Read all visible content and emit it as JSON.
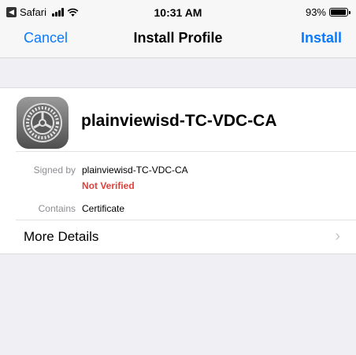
{
  "status_bar": {
    "app_name": "Safari",
    "time": "10:31 AM",
    "battery_percent": "93%",
    "battery_level": 0.93
  },
  "nav": {
    "cancel_label": "Cancel",
    "title": "Install Profile",
    "install_label": "Install"
  },
  "profile": {
    "name": "plainviewisd-TC-VDC-CA",
    "signed_by_label": "Signed by",
    "signed_by_value": "plainviewisd-TC-VDC-CA",
    "verification_status": "Not Verified",
    "contains_label": "Contains",
    "contains_value": "Certificate",
    "more_details_label": "More Details"
  },
  "colors": {
    "accent": "#0a7aff",
    "warning": "#e0413a"
  }
}
